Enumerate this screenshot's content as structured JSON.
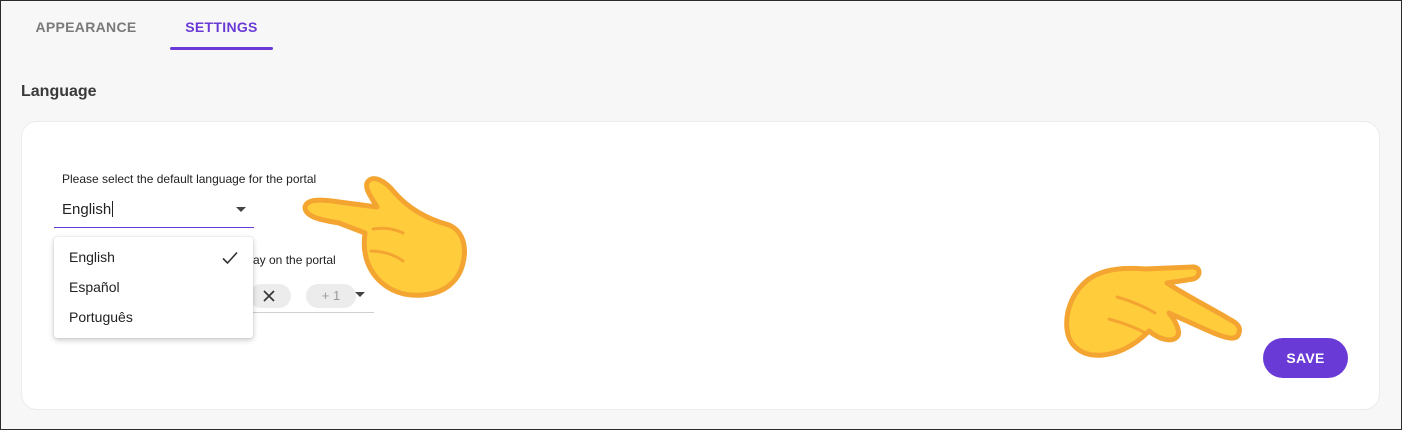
{
  "tabs": {
    "appearance": "APPEARANCE",
    "settings": "SETTINGS",
    "active": "SETTINGS"
  },
  "section": {
    "title": "Language"
  },
  "default_language": {
    "label": "Please select the default language for the portal",
    "value": "English"
  },
  "dropdown_menu": {
    "items": [
      {
        "label": "English",
        "selected": true
      },
      {
        "label": "Español",
        "selected": false
      },
      {
        "label": "Português",
        "selected": false
      }
    ]
  },
  "display_languages": {
    "label_visible_fragment": "ay on the portal",
    "chip_remove_icon": "close-icon",
    "more_chip": "+ 1"
  },
  "actions": {
    "save_label": "SAVE"
  },
  "colors": {
    "accent": "#6a3ad6",
    "hand_fill": "#ffcd3c",
    "hand_outline": "#f4a531"
  }
}
